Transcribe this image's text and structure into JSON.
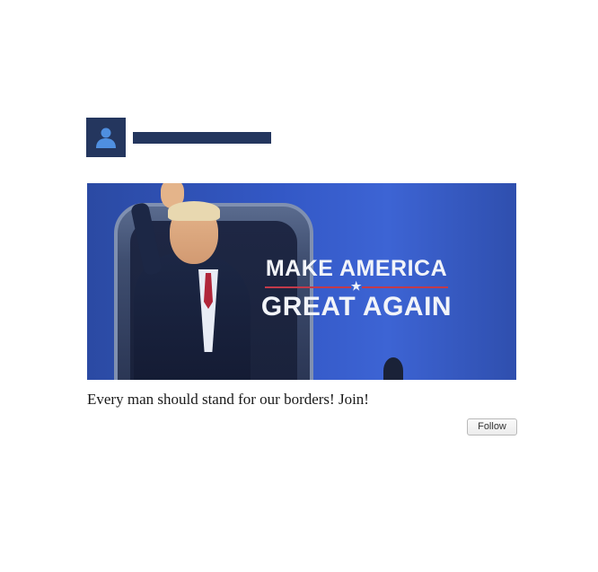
{
  "post": {
    "image_text": {
      "line1": "MAKE AMERICA",
      "line2": "GREAT AGAIN"
    },
    "caption": "Every man should stand for our borders! Join!",
    "follow_label": "Follow"
  },
  "colors": {
    "avatar_bg": "#24365e",
    "author_bar": "#24365e",
    "avatar_icon": "#4f8fe0",
    "image_blue": "#3358c6",
    "divider_red": "#c23a4a"
  },
  "icons": {
    "avatar": "user-silhouette-icon",
    "divider": "star-icon"
  }
}
